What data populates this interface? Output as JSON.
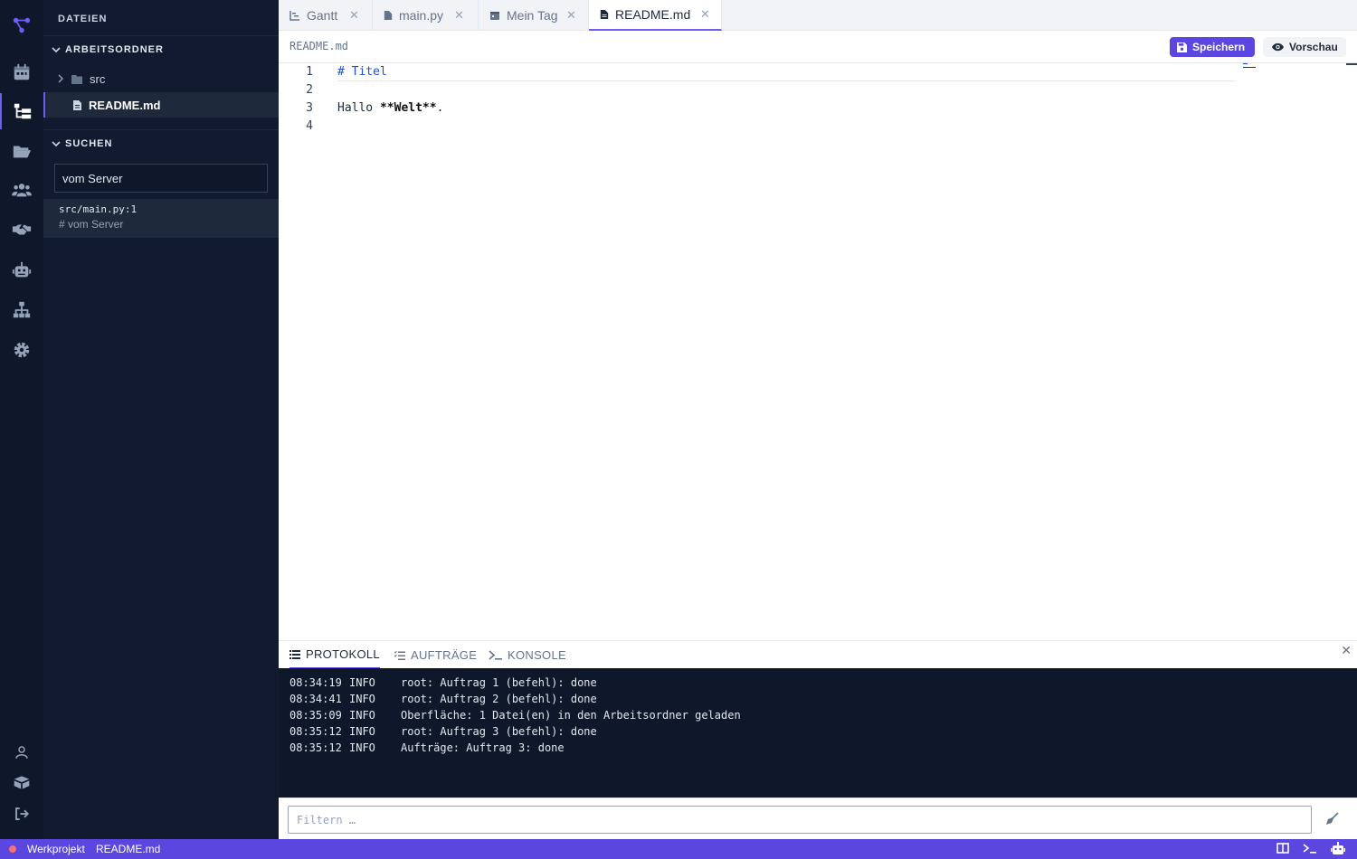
{
  "sidebar": {
    "title": "DATEIEN",
    "workspace_section": "ARBEITSORDNER",
    "tree": [
      {
        "label": "src",
        "type": "folder"
      },
      {
        "label": "README.md",
        "type": "file"
      }
    ],
    "search_section": "SUCHEN",
    "search_value": "vom Server",
    "search_result": {
      "path": "src/main.py:1",
      "snippet": "# vom Server"
    }
  },
  "tabs": [
    {
      "label": "Gantt",
      "icon": "chart-icon"
    },
    {
      "label": "main.py",
      "icon": "file-icon"
    },
    {
      "label": "Mein Tag",
      "icon": "calendar-icon"
    },
    {
      "label": "README.md",
      "icon": "file-icon",
      "active": true
    }
  ],
  "tab_close": "✕",
  "editor": {
    "breadcrumb": "README.md",
    "save_label": "Speichern",
    "preview_label": "Vorschau",
    "line_numbers": [
      "1",
      "2",
      "3",
      "4"
    ],
    "line1": "# Titel",
    "line3_pre": "Hallo ",
    "line3_bold": "**Welt**",
    "line3_post": "."
  },
  "panel": {
    "tabs": [
      "PROTOKOLL",
      "AUFTRÄGE",
      "KONSOLE"
    ],
    "close": "✕",
    "log": [
      {
        "time": "08:34:19",
        "level": "INFO",
        "msg": "root: Auftrag 1 (befehl): done"
      },
      {
        "time": "08:34:41",
        "level": "INFO",
        "msg": "root: Auftrag 2 (befehl): done"
      },
      {
        "time": "08:35:09",
        "level": "INFO",
        "msg": "Oberfläche: 1 Datei(en) in den Arbeitsordner geladen"
      },
      {
        "time": "08:35:12",
        "level": "INFO",
        "msg": "root: Auftrag 3 (befehl): done"
      },
      {
        "time": "08:35:12",
        "level": "INFO",
        "msg": "Aufträge: Auftrag 3: done"
      }
    ],
    "filter_placeholder": "Filtern …"
  },
  "status": {
    "project": "Werkprojekt",
    "file": "README.md"
  },
  "colors": {
    "accent": "#5b47e0",
    "sidebar_bg": "#111a2e",
    "activity_bg": "#0f172a",
    "status_dot": "#f87171"
  }
}
